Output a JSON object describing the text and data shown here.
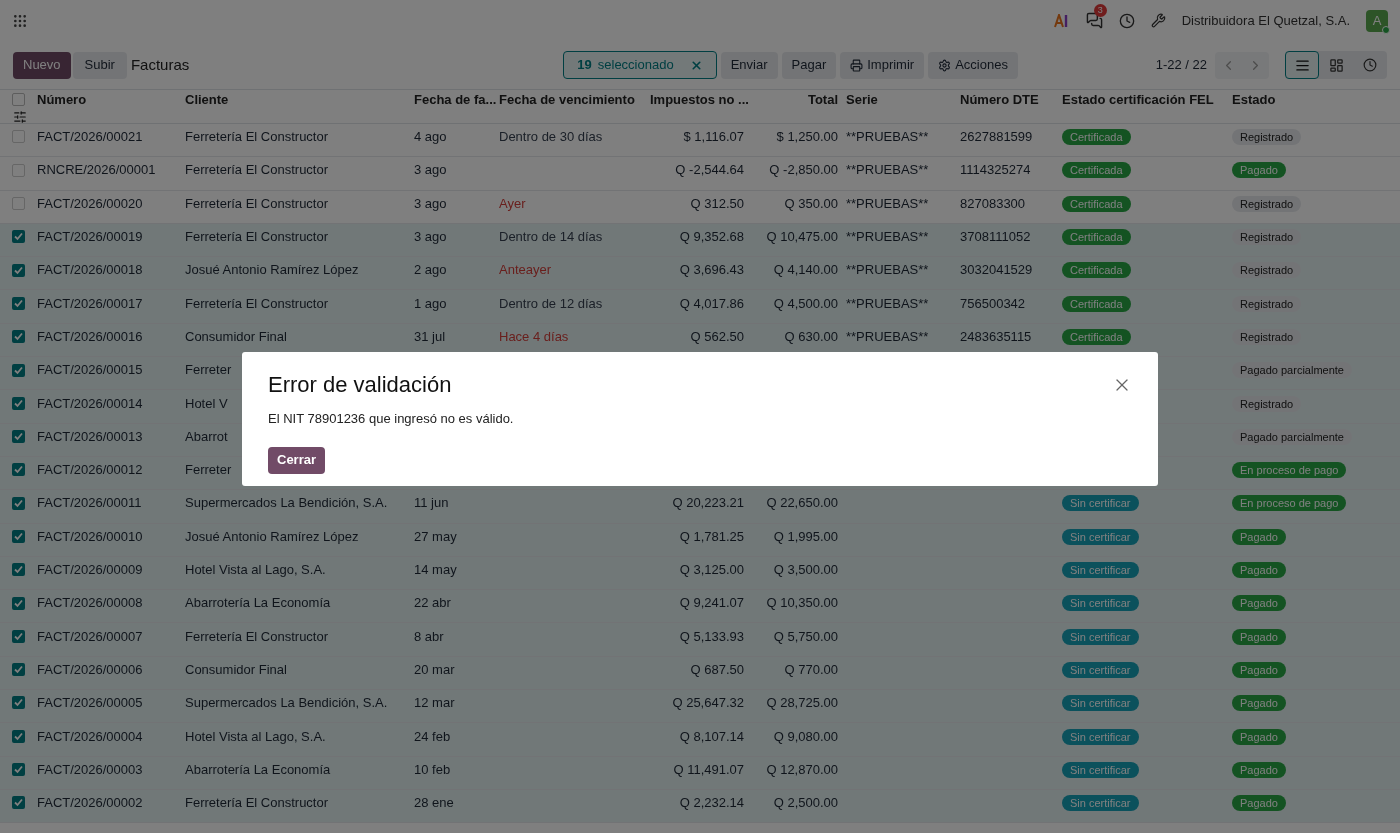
{
  "topbar": {
    "notifications": "3",
    "company": "Distribuidora El Quetzal, S.A.",
    "avatar": "A"
  },
  "control_panel": {
    "new_button": "Nuevo",
    "upload_button": "Subir",
    "title": "Facturas",
    "selection": {
      "count": "19",
      "label": "seleccionado"
    },
    "actions": [
      {
        "kind": "plain",
        "label": "Enviar"
      },
      {
        "kind": "plain",
        "label": "Pagar"
      },
      {
        "kind": "print",
        "label": "Imprimir"
      },
      {
        "kind": "gear",
        "label": "Acciones"
      }
    ],
    "pager": "1-22 / 22",
    "views": [
      {
        "kind": "list",
        "selected": true
      },
      {
        "kind": "kanban",
        "selected": false
      },
      {
        "kind": "activity",
        "selected": false
      }
    ]
  },
  "table": {
    "select_all_checked": false,
    "columns": [
      "Número",
      "Cliente",
      "Fecha de fa...",
      "Fecha de vencimiento",
      "Impuestos no ...",
      "Total",
      "Serie",
      "Número DTE",
      "Estado certificación FEL",
      "Estado"
    ],
    "rows": [
      {
        "selected": false,
        "number": "FACT/2026/00021",
        "client": "Ferretería El Constructor",
        "date": "4 ago",
        "due": {
          "text": "Dentro de 30 días",
          "kind": "normal"
        },
        "tax": "$ 1,116.07",
        "total": "$ 1,250.00",
        "serie": "**PRUEBAS**",
        "dte": "2627881599",
        "fel": {
          "text": "Certificada",
          "kind": "certified"
        },
        "state": {
          "text": "Registrado",
          "kind": "neutral"
        }
      },
      {
        "selected": false,
        "number": "RNCRE/2026/00001",
        "client": "Ferretería El Constructor",
        "date": "3 ago",
        "tax": "Q -2,544.64",
        "total": "Q -2,850.00",
        "serie": "**PRUEBAS**",
        "dte": "1114325274",
        "fel": {
          "text": "Certificada",
          "kind": "certified"
        },
        "state": {
          "text": "Pagado",
          "kind": "success"
        }
      },
      {
        "selected": false,
        "number": "FACT/2026/00020",
        "client": "Ferretería El Constructor",
        "date": "3 ago",
        "due": {
          "text": "Ayer",
          "kind": "overdue"
        },
        "tax": "Q 312.50",
        "total": "Q 350.00",
        "serie": "**PRUEBAS**",
        "dte": "827083300",
        "fel": {
          "text": "Certificada",
          "kind": "certified"
        },
        "state": {
          "text": "Registrado",
          "kind": "neutral"
        }
      },
      {
        "selected": true,
        "number": "FACT/2026/00019",
        "client": "Ferretería El Constructor",
        "date": "3 ago",
        "due": {
          "text": "Dentro de 14 días",
          "kind": "normal"
        },
        "tax": "Q 9,352.68",
        "total": "Q 10,475.00",
        "serie": "**PRUEBAS**",
        "dte": "3708111052",
        "fel": {
          "text": "Certificada",
          "kind": "certified"
        },
        "state": {
          "text": "Registrado",
          "kind": "neutral"
        }
      },
      {
        "selected": true,
        "number": "FACT/2026/00018",
        "client": "Josué Antonio Ramírez López",
        "date": "2 ago",
        "due": {
          "text": "Anteayer",
          "kind": "overdue"
        },
        "tax": "Q 3,696.43",
        "total": "Q 4,140.00",
        "serie": "**PRUEBAS**",
        "dte": "3032041529",
        "fel": {
          "text": "Certificada",
          "kind": "certified"
        },
        "state": {
          "text": "Registrado",
          "kind": "neutral"
        }
      },
      {
        "selected": true,
        "number": "FACT/2026/00017",
        "client": "Ferretería El Constructor",
        "date": "1 ago",
        "due": {
          "text": "Dentro de 12 días",
          "kind": "normal"
        },
        "tax": "Q 4,017.86",
        "total": "Q 4,500.00",
        "serie": "**PRUEBAS**",
        "dte": "756500342",
        "fel": {
          "text": "Certificada",
          "kind": "certified"
        },
        "state": {
          "text": "Registrado",
          "kind": "neutral"
        }
      },
      {
        "selected": true,
        "number": "FACT/2026/00016",
        "client": "Consumidor Final",
        "date": "31 jul",
        "due": {
          "text": "Hace 4 días",
          "kind": "overdue"
        },
        "tax": "Q 562.50",
        "total": "Q 630.00",
        "serie": "**PRUEBAS**",
        "dte": "2483635115",
        "fel": {
          "text": "Certificada",
          "kind": "certified"
        },
        "state": {
          "text": "Registrado",
          "kind": "neutral"
        }
      },
      {
        "selected": true,
        "number": "FACT/2026/00015",
        "client": "Ferreter",
        "state": {
          "text": "Pagado parcialmente",
          "kind": "neutral"
        }
      },
      {
        "selected": true,
        "number": "FACT/2026/00014",
        "client": "Hotel V",
        "state": {
          "text": "Registrado",
          "kind": "neutral"
        }
      },
      {
        "selected": true,
        "number": "FACT/2026/00013",
        "client": "Abarrot",
        "state": {
          "text": "Pagado parcialmente",
          "kind": "neutral"
        }
      },
      {
        "selected": true,
        "number": "FACT/2026/00012",
        "client": "Ferreter",
        "state": {
          "text": "En proceso de pago",
          "kind": "success"
        }
      },
      {
        "selected": true,
        "number": "FACT/2026/00011",
        "client": "Supermercados La Bendición, S.A.",
        "date": "11 jun",
        "tax": "Q 20,223.21",
        "total": "Q 22,650.00",
        "fel": {
          "text": "Sin certificar",
          "kind": "pending"
        },
        "state": {
          "text": "En proceso de pago",
          "kind": "success"
        }
      },
      {
        "selected": true,
        "number": "FACT/2026/00010",
        "client": "Josué Antonio Ramírez López",
        "date": "27 may",
        "tax": "Q 1,781.25",
        "total": "Q 1,995.00",
        "fel": {
          "text": "Sin certificar",
          "kind": "pending"
        },
        "state": {
          "text": "Pagado",
          "kind": "success"
        }
      },
      {
        "selected": true,
        "number": "FACT/2026/00009",
        "client": "Hotel Vista al Lago, S.A.",
        "date": "14 may",
        "tax": "Q 3,125.00",
        "total": "Q 3,500.00",
        "fel": {
          "text": "Sin certificar",
          "kind": "pending"
        },
        "state": {
          "text": "Pagado",
          "kind": "success"
        }
      },
      {
        "selected": true,
        "number": "FACT/2026/00008",
        "client": "Abarrotería La Economía",
        "date": "22 abr",
        "tax": "Q 9,241.07",
        "total": "Q 10,350.00",
        "fel": {
          "text": "Sin certificar",
          "kind": "pending"
        },
        "state": {
          "text": "Pagado",
          "kind": "success"
        }
      },
      {
        "selected": true,
        "number": "FACT/2026/00007",
        "client": "Ferretería El Constructor",
        "date": "8 abr",
        "tax": "Q 5,133.93",
        "total": "Q 5,750.00",
        "fel": {
          "text": "Sin certificar",
          "kind": "pending"
        },
        "state": {
          "text": "Pagado",
          "kind": "success"
        }
      },
      {
        "selected": true,
        "number": "FACT/2026/00006",
        "client": "Consumidor Final",
        "date": "20 mar",
        "tax": "Q 687.50",
        "total": "Q 770.00",
        "fel": {
          "text": "Sin certificar",
          "kind": "pending"
        },
        "state": {
          "text": "Pagado",
          "kind": "success"
        }
      },
      {
        "selected": true,
        "number": "FACT/2026/00005",
        "client": "Supermercados La Bendición, S.A.",
        "date": "12 mar",
        "tax": "Q 25,647.32",
        "total": "Q 28,725.00",
        "fel": {
          "text": "Sin certificar",
          "kind": "pending"
        },
        "state": {
          "text": "Pagado",
          "kind": "success"
        }
      },
      {
        "selected": true,
        "number": "FACT/2026/00004",
        "client": "Hotel Vista al Lago, S.A.",
        "date": "24 feb",
        "tax": "Q 8,107.14",
        "total": "Q 9,080.00",
        "fel": {
          "text": "Sin certificar",
          "kind": "pending"
        },
        "state": {
          "text": "Pagado",
          "kind": "success"
        }
      },
      {
        "selected": true,
        "number": "FACT/2026/00003",
        "client": "Abarrotería La Economía",
        "date": "10 feb",
        "tax": "Q 11,491.07",
        "total": "Q 12,870.00",
        "fel": {
          "text": "Sin certificar",
          "kind": "pending"
        },
        "state": {
          "text": "Pagado",
          "kind": "success"
        }
      },
      {
        "selected": true,
        "number": "FACT/2026/00002",
        "client": "Ferretería El Constructor",
        "date": "28 ene",
        "tax": "Q 2,232.14",
        "total": "Q 2,500.00",
        "fel": {
          "text": "Sin certificar",
          "kind": "pending"
        },
        "state": {
          "text": "Pagado",
          "kind": "success"
        }
      }
    ]
  },
  "dialog": {
    "title": "Error de validación",
    "message": "El NIT 78901236 que ingresó no es válido.",
    "button": "Cerrar"
  }
}
